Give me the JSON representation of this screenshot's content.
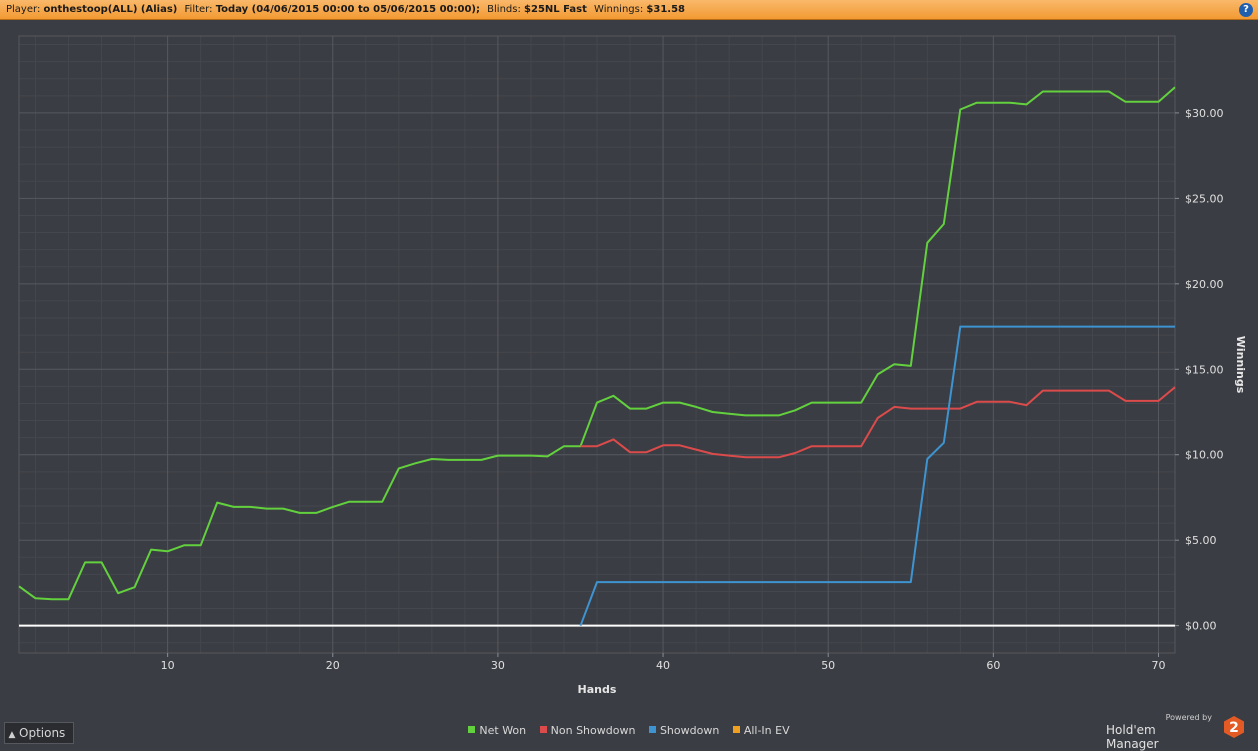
{
  "header": {
    "player_key": "Player:",
    "player": "onthestoop(ALL) (Alias)",
    "filter_key": "Filter:",
    "filter": "Today (04/06/2015 00:00 to 05/06/2015 00:00);",
    "blinds_key": "Blinds:",
    "blinds": "$25NL Fast",
    "winnings_key": "Winnings:",
    "winnings": "$31.58",
    "help": "?"
  },
  "options_button": {
    "label": "Options"
  },
  "branding": {
    "powered_by": "Powered by",
    "name": "Hold'em Manager",
    "logo_text": "2"
  },
  "colors": {
    "net_won": "#63d13e",
    "non_showdown": "#dc4b4b",
    "showdown": "#3e94d1",
    "all_in_ev": "#f0a020",
    "background": "#3a3d43",
    "grid": "#4d5057"
  },
  "chart_data": {
    "type": "line",
    "xlabel": "Hands",
    "ylabel": "Winnings",
    "xlim": [
      1,
      71
    ],
    "ylim": [
      -1.6,
      34.5
    ],
    "x_ticks": [
      10,
      20,
      30,
      40,
      50,
      60,
      70
    ],
    "y_ticks": [
      0,
      5,
      10,
      15,
      20,
      25,
      30
    ],
    "y_tick_labels": [
      "$0.00",
      "$5.00",
      "$10.00",
      "$15.00",
      "$20.00",
      "$25.00",
      "$30.00"
    ],
    "grid": true,
    "legend_position": "bottom-center",
    "series": [
      {
        "name": "Net Won",
        "color": "#63d13e",
        "points": [
          [
            1,
            2.3
          ],
          [
            2,
            1.6
          ],
          [
            3,
            1.55
          ],
          [
            4,
            1.55
          ],
          [
            5,
            3.7
          ],
          [
            6,
            3.7
          ],
          [
            7,
            1.9
          ],
          [
            8,
            2.25
          ],
          [
            9,
            4.45
          ],
          [
            10,
            4.35
          ],
          [
            11,
            4.7
          ],
          [
            12,
            4.7
          ],
          [
            13,
            7.2
          ],
          [
            14,
            6.95
          ],
          [
            15,
            6.95
          ],
          [
            16,
            6.85
          ],
          [
            17,
            6.85
          ],
          [
            18,
            6.6
          ],
          [
            19,
            6.6
          ],
          [
            20,
            6.95
          ],
          [
            21,
            7.25
          ],
          [
            22,
            7.25
          ],
          [
            23,
            7.25
          ],
          [
            24,
            9.2
          ],
          [
            25,
            9.5
          ],
          [
            26,
            9.75
          ],
          [
            27,
            9.7
          ],
          [
            28,
            9.7
          ],
          [
            29,
            9.7
          ],
          [
            30,
            9.95
          ],
          [
            31,
            9.95
          ],
          [
            32,
            9.95
          ],
          [
            33,
            9.9
          ],
          [
            34,
            10.5
          ],
          [
            35,
            10.5
          ],
          [
            36,
            13.05
          ],
          [
            37,
            13.45
          ],
          [
            38,
            12.7
          ],
          [
            39,
            12.7
          ],
          [
            40,
            13.05
          ],
          [
            41,
            13.05
          ],
          [
            42,
            12.8
          ],
          [
            43,
            12.5
          ],
          [
            44,
            12.4
          ],
          [
            45,
            12.3
          ],
          [
            46,
            12.3
          ],
          [
            47,
            12.3
          ],
          [
            48,
            12.6
          ],
          [
            49,
            13.05
          ],
          [
            50,
            13.05
          ],
          [
            51,
            13.05
          ],
          [
            52,
            13.05
          ],
          [
            53,
            14.7
          ],
          [
            54,
            15.3
          ],
          [
            55,
            15.2
          ],
          [
            56,
            22.4
          ],
          [
            57,
            23.5
          ],
          [
            58,
            30.2
          ],
          [
            59,
            30.6
          ],
          [
            60,
            30.6
          ],
          [
            61,
            30.6
          ],
          [
            62,
            30.5
          ],
          [
            63,
            31.25
          ],
          [
            64,
            31.25
          ],
          [
            65,
            31.25
          ],
          [
            66,
            31.25
          ],
          [
            67,
            31.25
          ],
          [
            68,
            30.65
          ],
          [
            69,
            30.65
          ],
          [
            70,
            30.65
          ],
          [
            71,
            31.5
          ]
        ]
      },
      {
        "name": "Non Showdown",
        "color": "#dc4b4b",
        "points": [
          [
            35,
            10.5
          ],
          [
            36,
            10.5
          ],
          [
            37,
            10.9
          ],
          [
            38,
            10.15
          ],
          [
            39,
            10.15
          ],
          [
            40,
            10.55
          ],
          [
            41,
            10.55
          ],
          [
            42,
            10.3
          ],
          [
            43,
            10.05
          ],
          [
            44,
            9.95
          ],
          [
            45,
            9.85
          ],
          [
            46,
            9.85
          ],
          [
            47,
            9.85
          ],
          [
            48,
            10.1
          ],
          [
            49,
            10.5
          ],
          [
            50,
            10.5
          ],
          [
            51,
            10.5
          ],
          [
            52,
            10.5
          ],
          [
            53,
            12.15
          ],
          [
            54,
            12.8
          ],
          [
            55,
            12.7
          ],
          [
            56,
            12.7
          ],
          [
            57,
            12.7
          ],
          [
            58,
            12.7
          ],
          [
            59,
            13.1
          ],
          [
            60,
            13.1
          ],
          [
            61,
            13.1
          ],
          [
            62,
            12.9
          ],
          [
            63,
            13.75
          ],
          [
            64,
            13.75
          ],
          [
            65,
            13.75
          ],
          [
            66,
            13.75
          ],
          [
            67,
            13.75
          ],
          [
            68,
            13.15
          ],
          [
            69,
            13.15
          ],
          [
            70,
            13.15
          ],
          [
            71,
            13.95
          ]
        ]
      },
      {
        "name": "Showdown",
        "color": "#3e94d1",
        "points": [
          [
            35,
            0
          ],
          [
            36,
            2.55
          ],
          [
            37,
            2.55
          ],
          [
            40,
            2.55
          ],
          [
            45,
            2.55
          ],
          [
            50,
            2.55
          ],
          [
            55,
            2.55
          ],
          [
            56,
            9.75
          ],
          [
            57,
            10.7
          ],
          [
            58,
            17.5
          ],
          [
            60,
            17.5
          ],
          [
            65,
            17.5
          ],
          [
            70,
            17.5
          ],
          [
            71,
            17.5
          ]
        ]
      },
      {
        "name": "All-In EV",
        "color": "#f0a020",
        "points": []
      }
    ]
  }
}
